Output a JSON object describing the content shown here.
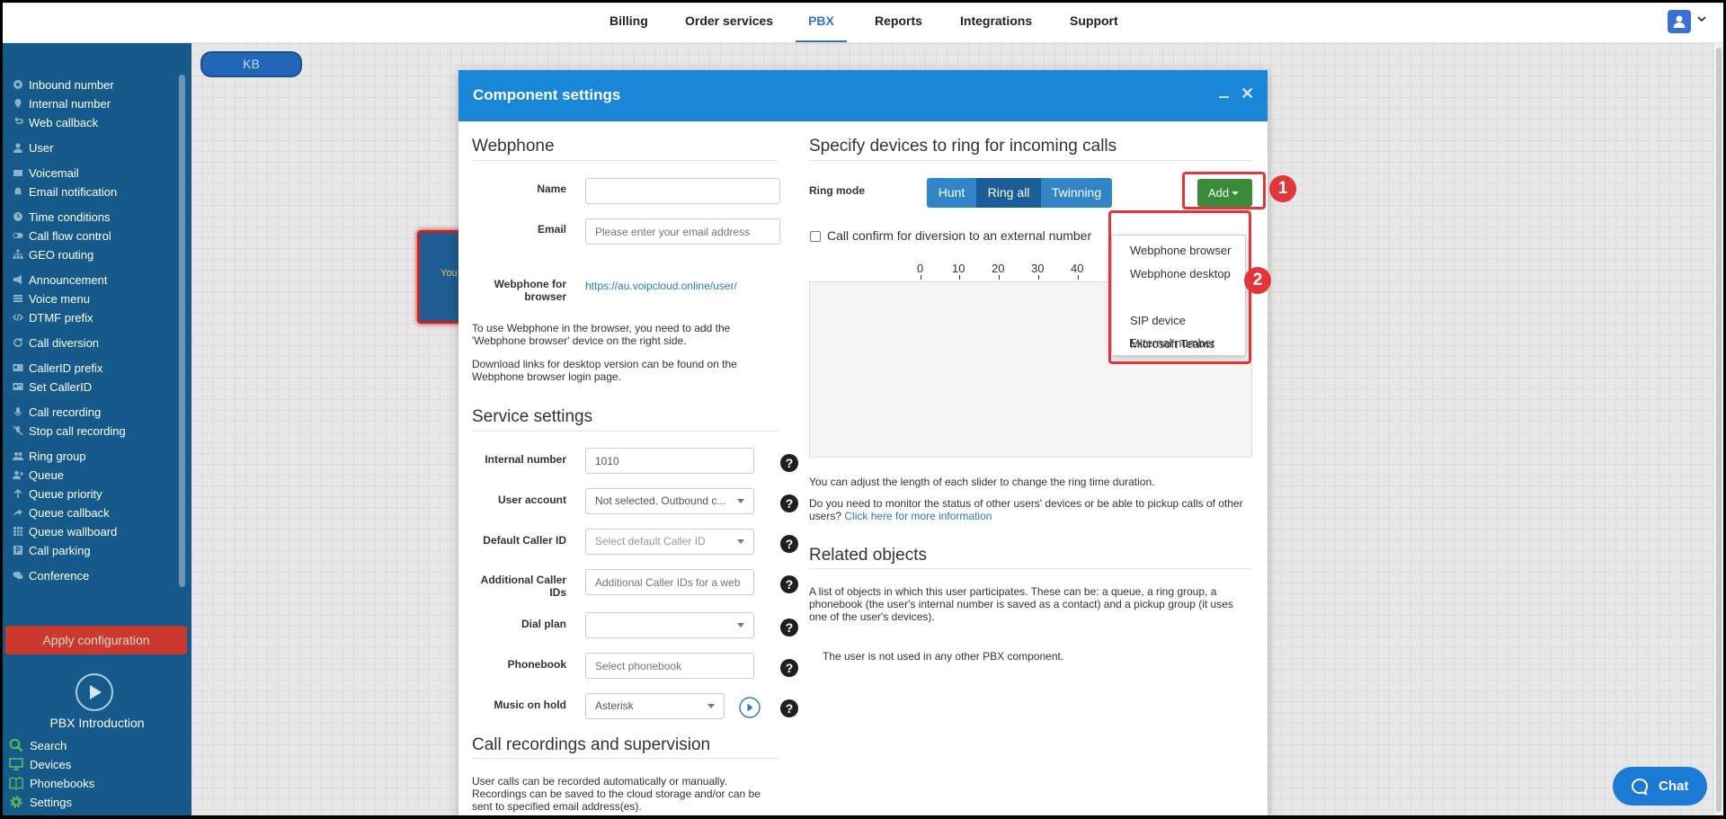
{
  "topnav": {
    "items": [
      "Billing",
      "Order services",
      "PBX",
      "Reports",
      "Integrations",
      "Support"
    ],
    "active": "PBX"
  },
  "sidebar": {
    "items": [
      {
        "label": "Inbound number",
        "icon": "circle-dot-icon"
      },
      {
        "label": "Internal number",
        "icon": "pin-icon"
      },
      {
        "label": "Web callback",
        "icon": "callback-icon"
      },
      {
        "label": "User",
        "icon": "user-icon"
      },
      {
        "label": "Voicemail",
        "icon": "envelope-icon"
      },
      {
        "label": "Email notification",
        "icon": "bell-icon"
      },
      {
        "label": "Time conditions",
        "icon": "clock-icon"
      },
      {
        "label": "Call flow control",
        "icon": "toggle-icon"
      },
      {
        "label": "GEO routing",
        "icon": "sitemap-icon"
      },
      {
        "label": "Announcement",
        "icon": "megaphone-icon"
      },
      {
        "label": "Voice menu",
        "icon": "menu-icon"
      },
      {
        "label": "DTMF prefix",
        "icon": "code-icon"
      },
      {
        "label": "Call diversion",
        "icon": "redirect-icon"
      },
      {
        "label": "CallerID prefix",
        "icon": "id-icon"
      },
      {
        "label": "Set CallerID",
        "icon": "id-card-icon"
      },
      {
        "label": "Call recording",
        "icon": "mic-icon"
      },
      {
        "label": "Stop call recording",
        "icon": "mic-off-icon"
      },
      {
        "label": "Ring group",
        "icon": "users-icon"
      },
      {
        "label": "Queue",
        "icon": "user-plus-icon"
      },
      {
        "label": "Queue priority",
        "icon": "arrow-up-icon"
      },
      {
        "label": "Queue callback",
        "icon": "share-icon"
      },
      {
        "label": "Queue wallboard",
        "icon": "grid-icon"
      },
      {
        "label": "Call parking",
        "icon": "parking-icon"
      },
      {
        "label": "Conference",
        "icon": "chat-icon"
      }
    ],
    "apply_label": "Apply configuration",
    "intro_label": "PBX Introduction",
    "bottom": [
      {
        "label": "Search",
        "icon": "search-icon"
      },
      {
        "label": "Devices",
        "icon": "monitor-icon"
      },
      {
        "label": "Phonebooks",
        "icon": "book-icon"
      },
      {
        "label": "Settings",
        "icon": "gear-icon"
      }
    ]
  },
  "canvas": {
    "kb_label": "KB",
    "node_text": "You"
  },
  "modal": {
    "title": "Component settings",
    "webphone": {
      "title": "Webphone",
      "name_label": "Name",
      "name_value": "",
      "email_label": "Email",
      "email_placeholder": "Please enter your email address",
      "browser_label": "Webphone for browser",
      "browser_link": "https://au.voipcloud.online/user/",
      "note1": "To use Webphone in the browser, you need to add the 'Webphone browser' device on the right side.",
      "note2": "Download links for desktop version can be found on the Webphone browser login page."
    },
    "service": {
      "title": "Service settings",
      "internal_label": "Internal number",
      "internal_value": "1010",
      "account_label": "User account",
      "account_value": "Not selected. Outbound c...",
      "default_cid_label": "Default Caller ID",
      "default_cid_placeholder": "Select default Caller ID",
      "additional_label": "Additional Caller IDs",
      "additional_placeholder": "Additional Caller IDs for a web",
      "dialplan_label": "Dial plan",
      "dialplan_value": "",
      "phonebook_label": "Phonebook",
      "phonebook_placeholder": "Select phonebook",
      "moh_label": "Music on hold",
      "moh_value": "Asterisk"
    },
    "recordings": {
      "title": "Call recordings and supervision",
      "note": "User calls can be recorded automatically or manually. Recordings can be saved to the cloud storage and/or can be sent to specified email address(es)."
    },
    "devices": {
      "title": "Specify devices to ring for incoming calls",
      "ring_mode_label": "Ring mode",
      "modes": [
        "Hunt",
        "Ring all",
        "Twinning"
      ],
      "active_mode": "Ring all",
      "add_label": "Add",
      "confirm_label": "Call confirm for diversion to an external number",
      "axis": [
        "0",
        "10",
        "20",
        "30",
        "40"
      ],
      "slider_note": "You can adjust the length of each slider to change the ring time duration.",
      "monitor_note": "Do you need to monitor the status of other users' devices or be able to pickup calls of other users?",
      "monitor_link": "Click here for more information",
      "dropdown": [
        "Webphone browser",
        "Webphone desktop",
        "SIP device",
        "Microsoft Teams",
        "External number"
      ]
    },
    "related": {
      "title": "Related objects",
      "note": "A list of objects in which this user participates. These can be: a queue, a ring group, a phonebook (the user's internal number is saved as a contact) and a pickup group (it uses one of the user's devices).",
      "empty": "The user is not used in any other PBX component."
    }
  },
  "annotations": [
    "1",
    "2"
  ],
  "chat_label": "Chat",
  "colors": {
    "primary": "#1a86d8",
    "sidebar": "#155a8a",
    "add_button": "#3a8a3a",
    "apply_button": "#c9392e",
    "annotation": "#e4363a"
  }
}
